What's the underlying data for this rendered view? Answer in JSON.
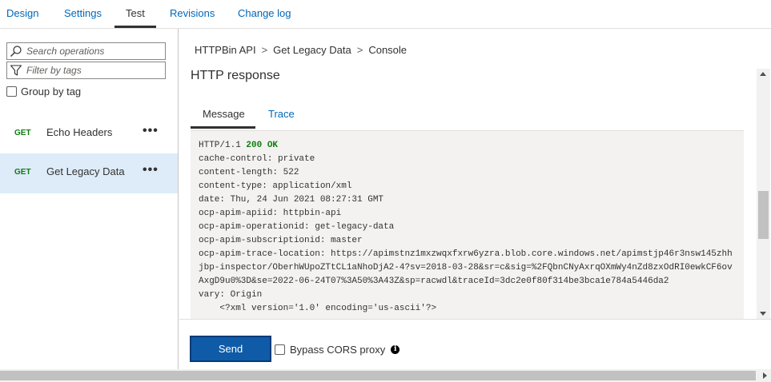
{
  "top_tabs": {
    "items": [
      {
        "label": "Design"
      },
      {
        "label": "Settings"
      },
      {
        "label": "Test"
      },
      {
        "label": "Revisions"
      },
      {
        "label": "Change log"
      }
    ],
    "active": "Test"
  },
  "left_pane": {
    "search_placeholder": "Search operations",
    "filter_placeholder": "Filter by tags",
    "group_by_label": "Group by tag",
    "group_by_checked": false,
    "operations": [
      {
        "method": "GET",
        "name": "Echo Headers",
        "more": "•••",
        "selected": false
      },
      {
        "method": "GET",
        "name": "Get Legacy Data",
        "more": "•••",
        "selected": true
      }
    ]
  },
  "breadcrumb": {
    "items": [
      "HTTPBin API",
      "Get Legacy Data",
      "Console"
    ],
    "separator": ">"
  },
  "response": {
    "title": "HTTP response",
    "tabs": [
      {
        "label": "Message"
      },
      {
        "label": "Trace"
      }
    ],
    "active_tab": "Message",
    "status_prefix": "HTTP/1.1 ",
    "status_code": "200 OK",
    "headers": [
      "cache-control: private",
      "content-length: 522",
      "content-type: application/xml",
      "date: Thu, 24 Jun 2021 08:27:31 GMT",
      "ocp-apim-apiid: httpbin-api",
      "ocp-apim-operationid: get-legacy-data",
      "ocp-apim-subscriptionid: master",
      "ocp-apim-trace-location: https://apimstnz1mxzwqxfxrw6yzra.blob.core.windows.net/apimstjp46r3nsw145zhhjbp-inspector/OberhWUpoZTtCL1aNhoDjA2-4?sv=2018-03-28&sr=c&sig=%2FQbnCNyAxrqOXmWy4nZd8zxOdRI0ewkCF6ovAxgD9u0%3D&se=2022-06-24T07%3A50%3A43Z&sp=racwdl&traceId=3dc2e0f80f314be3bca1e784a5446da2",
      "vary: Origin",
      "    <?xml version='1.0' encoding='us-ascii'?>"
    ]
  },
  "action_bar": {
    "send_label": "Send",
    "bypass_label": "Bypass CORS proxy",
    "bypass_checked": false,
    "info_glyph": "i"
  },
  "colors": {
    "link": "#0067b8",
    "send_button": "#0f5ba7",
    "method_get": "#107c10",
    "status_ok": "#107c10",
    "selected_row": "#deecf9"
  },
  "icons": {
    "search": "search-icon",
    "filter": "filter-icon",
    "info": "info-icon"
  }
}
